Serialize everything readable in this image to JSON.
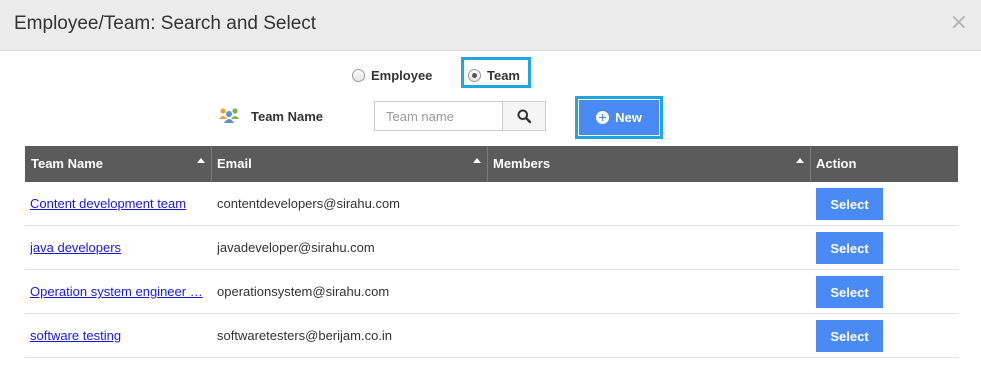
{
  "dialog": {
    "title": "Employee/Team: Search and Select",
    "close_icon": "×"
  },
  "filter": {
    "employee_label": "Employee",
    "team_label": "Team",
    "selected": "Team"
  },
  "search": {
    "label": "Team Name",
    "placeholder": "Team name",
    "value": "",
    "search_icon": "search-icon",
    "new_label": "New"
  },
  "table": {
    "columns": [
      "Team Name",
      "Email",
      "Members",
      "Action"
    ],
    "rows": [
      {
        "team": "Content development team",
        "email": "contentdevelopers@sirahu.com",
        "members": "",
        "action": "Select"
      },
      {
        "team": "java developers",
        "email": "javadeveloper@sirahu.com",
        "members": "",
        "action": "Select"
      },
      {
        "team": "Operation system engineer …",
        "email": "operationsystem@sirahu.com",
        "members": "",
        "action": "Select"
      },
      {
        "team": "software testing",
        "email": "softwaretesters@berijam.co.in",
        "members": "",
        "action": "Select"
      }
    ]
  },
  "colors": {
    "accent": "#4a8af4",
    "highlight_border": "#1ea7e0",
    "table_header": "#5b5b5b",
    "link": "#1a1adc"
  }
}
